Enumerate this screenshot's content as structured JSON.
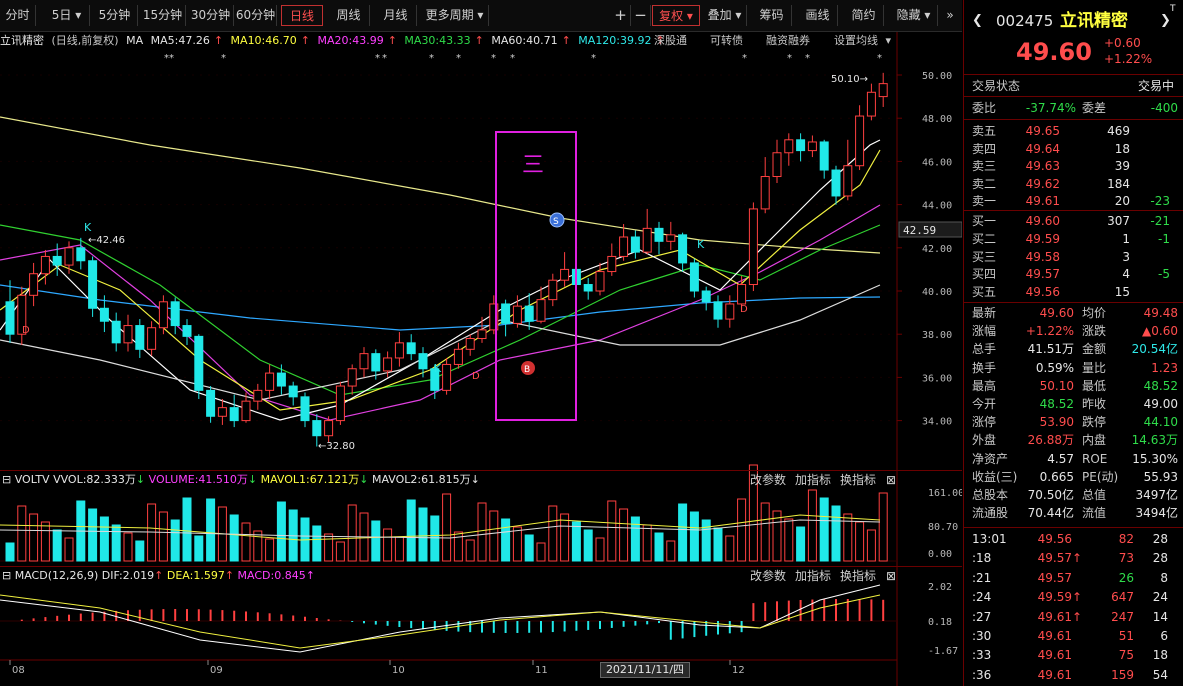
{
  "toolbar": {
    "tabs": [
      "分时",
      "5日",
      "5分钟",
      "15分钟",
      "30分钟",
      "60分钟",
      "日线",
      "周线",
      "月线",
      "更多周期"
    ],
    "right": [
      "复权",
      "叠加",
      "筹码",
      "画线",
      "简约",
      "隐藏"
    ]
  },
  "legend": {
    "title": "立讯精密",
    "mode": "(日线,前复权)",
    "ma_label": "MA",
    "ma5": "MA5:47.26",
    "ma10": "MA10:46.70",
    "ma20": "MA20:43.99",
    "ma30": "MA30:43.33",
    "ma60": "MA60:40.71",
    "ma120": "MA120:39.92",
    "links": [
      "深股通",
      "可转债",
      "融资融券",
      "设置均线"
    ]
  },
  "price_axis": [
    "50.00",
    "48.00",
    "46.00",
    "44.00",
    "42.00",
    "40.00",
    "38.00",
    "36.00",
    "34.00"
  ],
  "current_price_tag": "42.59",
  "annotations": {
    "high": "50.10",
    "low": "32.80",
    "k_price": "42.46",
    "box_glyph": "三"
  },
  "vol_pane": {
    "label": "VOLTV",
    "vvol": "VVOL:82.333万",
    "volume": "VOLUME:41.510万",
    "mavol1": "MAVOL1:67.121万",
    "mavol2": "MAVOL2:61.815万",
    "axis": [
      "161.00",
      "80.70",
      "0.00"
    ],
    "buttons": [
      "改参数",
      "加指标",
      "换指标"
    ]
  },
  "macd_pane": {
    "label": "MACD(12,26,9)",
    "dif": "DIF:2.019",
    "dea": "DEA:1.597",
    "macd": "MACD:0.845",
    "axis": [
      "2.02",
      "0.18",
      "-1.67"
    ],
    "buttons": [
      "改参数",
      "加指标",
      "换指标"
    ]
  },
  "date_axis": {
    "labels": [
      "08",
      "09",
      "10",
      "11",
      "12"
    ],
    "cursor": "2021/11/11/四"
  },
  "quote": {
    "code": "002475",
    "name": "立讯精密",
    "price": "49.60",
    "change": "+0.60",
    "change_pct": "+1.22%",
    "status_label": "交易状态",
    "status": "交易中",
    "wb_label": "委比",
    "wb": "-37.74%",
    "wc_label": "委差",
    "wc": "-400",
    "asks": [
      {
        "label": "卖五",
        "price": "49.65",
        "vol": "469",
        "chg": ""
      },
      {
        "label": "卖四",
        "price": "49.64",
        "vol": "18",
        "chg": ""
      },
      {
        "label": "卖三",
        "price": "49.63",
        "vol": "39",
        "chg": ""
      },
      {
        "label": "卖二",
        "price": "49.62",
        "vol": "184",
        "chg": ""
      },
      {
        "label": "卖一",
        "price": "49.61",
        "vol": "20",
        "chg": "-23"
      }
    ],
    "bids": [
      {
        "label": "买一",
        "price": "49.60",
        "vol": "307",
        "chg": "-21"
      },
      {
        "label": "买二",
        "price": "49.59",
        "vol": "1",
        "chg": "-1"
      },
      {
        "label": "买三",
        "price": "49.58",
        "vol": "3",
        "chg": ""
      },
      {
        "label": "买四",
        "price": "49.57",
        "vol": "4",
        "chg": "-5"
      },
      {
        "label": "买五",
        "price": "49.56",
        "vol": "15",
        "chg": ""
      }
    ],
    "stats": [
      {
        "l1": "最新",
        "v1": "49.60",
        "c1": "red",
        "l2": "均价",
        "v2": "49.48",
        "c2": "red"
      },
      {
        "l1": "涨幅",
        "v1": "+1.22%",
        "c1": "red",
        "l2": "涨跌",
        "v2": "▲0.60",
        "c2": "red"
      },
      {
        "l1": "总手",
        "v1": "41.51万",
        "c1": "white",
        "l2": "金额",
        "v2": "20.54亿",
        "c2": "cyan"
      },
      {
        "l1": "换手",
        "v1": "0.59%",
        "c1": "white",
        "l2": "量比",
        "v2": "1.23",
        "c2": "red"
      },
      {
        "l1": "最高",
        "v1": "50.10",
        "c1": "red",
        "l2": "最低",
        "v2": "48.52",
        "c2": "green"
      },
      {
        "l1": "今开",
        "v1": "48.52",
        "c1": "green",
        "l2": "昨收",
        "v2": "49.00",
        "c2": "white"
      },
      {
        "l1": "涨停",
        "v1": "53.90",
        "c1": "red",
        "l2": "跌停",
        "v2": "44.10",
        "c2": "green"
      },
      {
        "l1": "外盘",
        "v1": "26.88万",
        "c1": "red",
        "l2": "内盘",
        "v2": "14.63万",
        "c2": "green"
      },
      {
        "l1": "净资产",
        "v1": "4.57",
        "c1": "white",
        "l2": "ROE",
        "v2": "15.30%",
        "c2": "white"
      },
      {
        "l1": "收益(三)",
        "v1": "0.665",
        "c1": "white",
        "l2": "PE(动)",
        "v2": "55.93",
        "c2": "white"
      },
      {
        "l1": "总股本",
        "v1": "70.50亿",
        "c1": "white",
        "l2": "总值",
        "v2": "3497亿",
        "c2": "white"
      },
      {
        "l1": "流通股",
        "v1": "70.44亿",
        "c1": "white",
        "l2": "流值",
        "v2": "3494亿",
        "c2": "white"
      }
    ],
    "ticks": [
      {
        "time": "13:01",
        "price": "49.56",
        "arrow": "",
        "vol": "82",
        "vc": "red",
        "n": "28"
      },
      {
        "time": ":18",
        "price": "49.57",
        "arrow": "↑",
        "vol": "73",
        "vc": "red",
        "n": "28"
      },
      {
        "time": ":21",
        "price": "49.57",
        "arrow": "",
        "vol": "26",
        "vc": "green",
        "n": "8"
      },
      {
        "time": ":24",
        "price": "49.59",
        "arrow": "↑",
        "vol": "647",
        "vc": "red",
        "n": "24"
      },
      {
        "time": ":27",
        "price": "49.61",
        "arrow": "↑",
        "vol": "247",
        "vc": "red",
        "n": "14"
      },
      {
        "time": ":30",
        "price": "49.61",
        "arrow": "",
        "vol": "51",
        "vc": "red",
        "n": "6"
      },
      {
        "time": ":33",
        "price": "49.61",
        "arrow": "",
        "vol": "75",
        "vc": "red",
        "n": "18"
      },
      {
        "time": ":36",
        "price": "49.61",
        "arrow": "",
        "vol": "159",
        "vc": "red",
        "n": "54"
      }
    ]
  }
}
